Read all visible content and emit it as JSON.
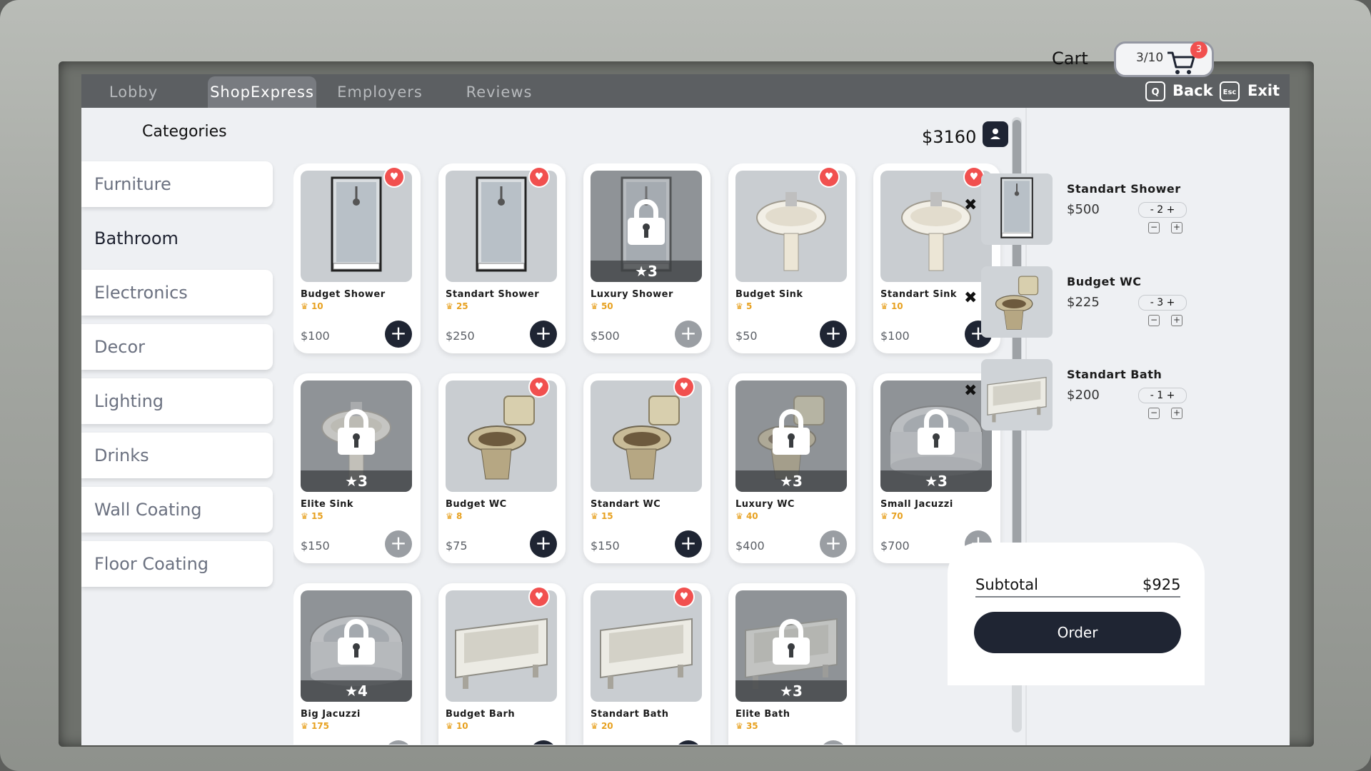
{
  "tabs": [
    {
      "label": "Lobby",
      "active": false
    },
    {
      "label": "ShopExpress",
      "active": true
    },
    {
      "label": "Employers",
      "active": false
    },
    {
      "label": "Reviews",
      "active": false
    }
  ],
  "top_actions": {
    "back_key": "Q",
    "back_label": "Back",
    "exit_key": "Esc",
    "exit_label": "Exit"
  },
  "categories": {
    "title": "Categories",
    "items": [
      "Furniture",
      "Bathroom",
      "Electronics",
      "Decor",
      "Lighting",
      "Drinks",
      "Wall Coating",
      "Floor Coating"
    ],
    "active": "Bathroom"
  },
  "money": "$3160",
  "products": [
    {
      "name": "Budget Shower",
      "level": "10",
      "price": "$100",
      "favorite": true,
      "locked": false,
      "icon": "shower-icon"
    },
    {
      "name": "Standart Shower",
      "level": "25",
      "price": "$250",
      "favorite": true,
      "locked": false,
      "icon": "shower-icon"
    },
    {
      "name": "Luxury Shower",
      "level": "50",
      "price": "$500",
      "favorite": false,
      "locked": true,
      "stars": "3",
      "icon": "shower-icon"
    },
    {
      "name": "Budget Sink",
      "level": "5",
      "price": "$50",
      "favorite": true,
      "locked": false,
      "icon": "sink-icon"
    },
    {
      "name": "Standart Sink",
      "level": "10",
      "price": "$100",
      "favorite": true,
      "locked": false,
      "icon": "sink-icon"
    },
    {
      "name": "Elite Sink",
      "level": "15",
      "price": "$150",
      "favorite": false,
      "locked": true,
      "stars": "3",
      "icon": "sink-icon"
    },
    {
      "name": "Budget WC",
      "level": "8",
      "price": "$75",
      "favorite": true,
      "locked": false,
      "icon": "toilet-icon"
    },
    {
      "name": "Standart WC",
      "level": "15",
      "price": "$150",
      "favorite": true,
      "locked": false,
      "icon": "toilet-icon"
    },
    {
      "name": "Luxury WC",
      "level": "40",
      "price": "$400",
      "favorite": false,
      "locked": true,
      "stars": "3",
      "icon": "toilet-icon"
    },
    {
      "name": "Small Jacuzzi",
      "level": "70",
      "price": "$700",
      "favorite": false,
      "locked": true,
      "stars": "3",
      "icon": "jacuzzi-icon"
    },
    {
      "name": "Big Jacuzzi",
      "level": "175",
      "price": "",
      "favorite": false,
      "locked": true,
      "stars": "4",
      "icon": "jacuzzi-icon"
    },
    {
      "name": "Budget Barh",
      "level": "10",
      "price": "",
      "favorite": true,
      "locked": false,
      "icon": "bathtub-icon"
    },
    {
      "name": "Standart Bath",
      "level": "20",
      "price": "",
      "favorite": true,
      "locked": false,
      "icon": "bathtub-icon"
    },
    {
      "name": "Elite Bath",
      "level": "35",
      "price": "",
      "favorite": false,
      "locked": true,
      "stars": "3",
      "icon": "bathtub-icon"
    }
  ],
  "cart": {
    "title": "Cart",
    "capacity": "3/10",
    "badge": "3",
    "items": [
      {
        "name": "Standart Shower",
        "price": "$500",
        "qty": "- 2 +",
        "icon": "shower-icon"
      },
      {
        "name": "Budget WC",
        "price": "$225",
        "qty": "- 3 +",
        "icon": "toilet-icon"
      },
      {
        "name": "Standart Bath",
        "price": "$200",
        "qty": "- 1 +",
        "icon": "bathtub-icon"
      }
    ],
    "subtotal_label": "Subtotal",
    "subtotal_value": "$925",
    "order_label": "Order"
  },
  "colors": {
    "accent_dark": "#1f2533",
    "favorite_red": "#f1504f",
    "level_gold": "#e7a120"
  }
}
